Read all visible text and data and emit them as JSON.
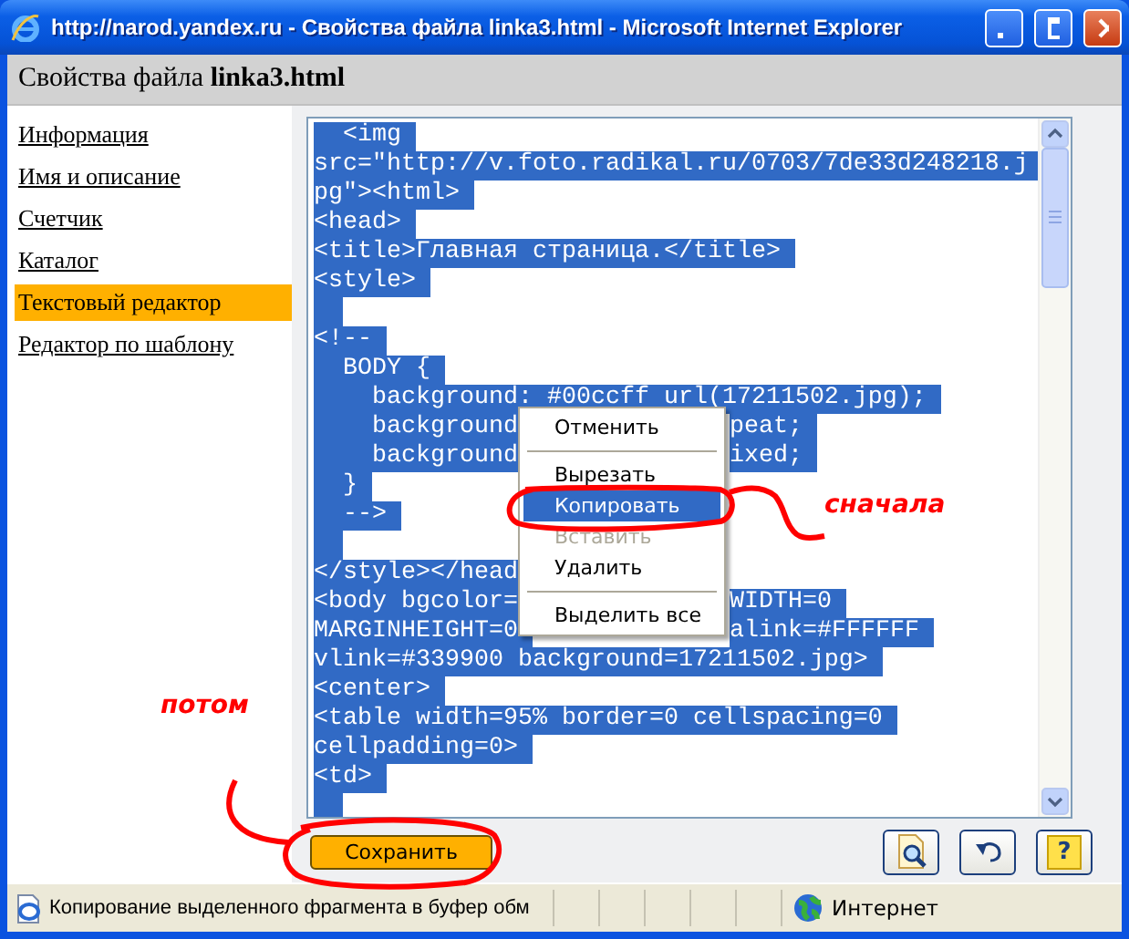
{
  "window": {
    "title": "http://narod.yandex.ru - Свойства файла linka3.html - Microsoft Internet Explorer"
  },
  "page_header": {
    "text": "Свойства файла **linka3.html**"
  },
  "sidebar": {
    "items": [
      {
        "label": "Информация",
        "selected": false
      },
      {
        "label": "Имя и описание",
        "selected": false
      },
      {
        "label": "Счетчик",
        "selected": false
      },
      {
        "label": "Каталог",
        "selected": false
      },
      {
        "label": "Текстовый редактор",
        "selected": true
      },
      {
        "label": "Редактор по шаблону",
        "selected": false
      }
    ]
  },
  "editor": {
    "lines": [
      {
        "kind": "text",
        "text": "  <img",
        "selected": true
      },
      {
        "kind": "text",
        "text": "src=\"http://v.foto.radikal.ru/0703/7de33d248218.j",
        "selected": true
      },
      {
        "kind": "text",
        "text": "pg\"><html>",
        "selected": true
      },
      {
        "kind": "text",
        "text": "<head>",
        "selected": true
      },
      {
        "kind": "text",
        "text": "<title>Главная страница.</title>",
        "selected": true
      },
      {
        "kind": "text",
        "text": "<style>",
        "selected": true
      },
      {
        "kind": "blank",
        "selected": true
      },
      {
        "kind": "text",
        "text": "<!--",
        "selected": true
      },
      {
        "kind": "text",
        "text": "  BODY {",
        "selected": true
      },
      {
        "kind": "text",
        "text": "    background: #00ccff url(17211502.jpg);",
        "selected": true
      },
      {
        "kind": "text",
        "text": "    background",
        "after": "peat;",
        "selected": true
      },
      {
        "kind": "text",
        "text": "    background",
        "after": "ixed;",
        "selected": true
      },
      {
        "kind": "text",
        "text": "  }",
        "selected": true
      },
      {
        "kind": "text",
        "text": "  -->",
        "selected": true
      },
      {
        "kind": "blank",
        "selected": true
      },
      {
        "kind": "text",
        "text": "</style></head",
        "selected": true
      },
      {
        "kind": "text",
        "text": "<body bgcolor=",
        "after": "WIDTH=0",
        "selected": true
      },
      {
        "kind": "text",
        "text": "MARGINHEIGHT=0",
        "after": "alink=#FFFFFF",
        "selected": true
      },
      {
        "kind": "text",
        "text": "vlink=#339900 background=17211502.jpg>",
        "selected": true
      },
      {
        "kind": "text",
        "text": "<center>",
        "selected": true
      },
      {
        "kind": "text",
        "text": "<table width=95% border=0 cellspacing=0",
        "selected": true
      },
      {
        "kind": "text",
        "text": "cellpadding=0>",
        "selected": true
      },
      {
        "kind": "text",
        "text": "<td>",
        "selected": true
      },
      {
        "kind": "blank",
        "selected": true
      }
    ]
  },
  "context_menu": {
    "items": [
      {
        "kind": "item",
        "label": "Отменить",
        "selected": false,
        "disabled": false
      },
      {
        "kind": "separator"
      },
      {
        "kind": "item",
        "label": "Вырезать",
        "selected": false,
        "disabled": false
      },
      {
        "kind": "item",
        "label": "Копировать",
        "selected": true,
        "disabled": false
      },
      {
        "kind": "item",
        "label": "Вставить",
        "selected": false,
        "disabled": true
      },
      {
        "kind": "item",
        "label": "Удалить",
        "selected": false,
        "disabled": false
      },
      {
        "kind": "separator"
      },
      {
        "kind": "item",
        "label": "Выделить все",
        "selected": false,
        "disabled": false
      }
    ]
  },
  "annotations": [
    {
      "kind": "first",
      "text": "сначала"
    },
    {
      "kind": "then",
      "text": "потом"
    }
  ],
  "save_button": {
    "label": "Сохранить"
  },
  "help_button": {
    "label": "?"
  },
  "status_bar": {
    "text": "Копирование выделенного фрагмента в буфер обм",
    "zone": "Интернет"
  }
}
